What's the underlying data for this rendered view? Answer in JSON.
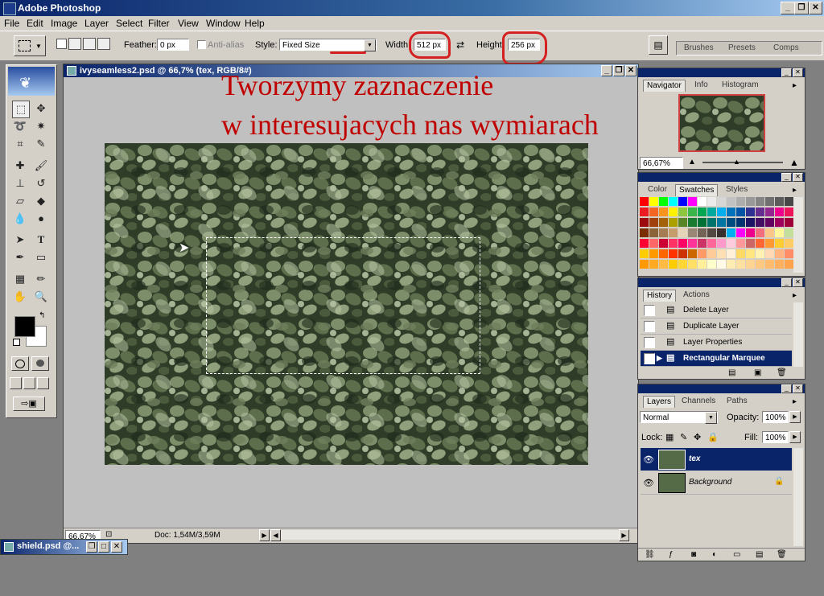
{
  "app": {
    "title": "Adobe Photoshop"
  },
  "menu": [
    "File",
    "Edit",
    "Image",
    "Layer",
    "Select",
    "Filter",
    "View",
    "Window",
    "Help"
  ],
  "options": {
    "feather_label": "Feather:",
    "feather_value": "0 px",
    "antialias_label": "Anti-alias",
    "style_label": "Style:",
    "style_value": "Fixed Size",
    "width_label": "Width:",
    "width_value": "512 px",
    "height_label": "Height:",
    "height_value": "256 px",
    "palette_tabs": [
      "Brushes",
      "Presets",
      "Comps"
    ]
  },
  "annotation": {
    "line1": "Tworzymy zaznaczenie",
    "line2": "w interesujacych nas wymiarach",
    "color": "#c00000"
  },
  "document": {
    "title": "ivyseamless2.psd @ 66,7% (tex, RGB/8#)",
    "zoom": "66,67%",
    "doc_size": "Doc: 1,54M/3,59M"
  },
  "navigator": {
    "tabs": [
      "Navigator",
      "Info",
      "Histogram"
    ],
    "zoom": "66,67%"
  },
  "color_panel": {
    "tabs": [
      "Color",
      "Swatches",
      "Styles"
    ]
  },
  "history": {
    "tabs": [
      "History",
      "Actions"
    ],
    "items": [
      "Delete Layer",
      "Duplicate Layer",
      "Layer Properties",
      "Rectangular Marquee"
    ]
  },
  "layers": {
    "tabs": [
      "Layers",
      "Channels",
      "Paths"
    ],
    "blend_mode": "Normal",
    "opacity_label": "Opacity:",
    "opacity_value": "100%",
    "lock_label": "Lock:",
    "fill_label": "Fill:",
    "fill_value": "100%",
    "items": [
      "tex",
      "Background"
    ]
  },
  "minimized_window": {
    "title": "shield.psd @..."
  },
  "colors": {
    "selection_blue": "#0a246a",
    "foreground": "#000000",
    "background": "#ffffff"
  }
}
